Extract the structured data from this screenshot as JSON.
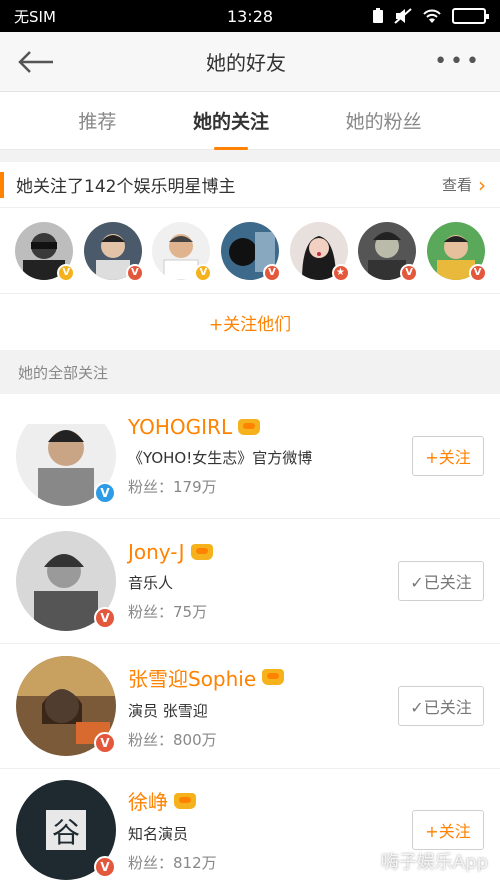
{
  "status_bar": {
    "carrier": "无SIM",
    "time": "13:28"
  },
  "nav": {
    "title": "她的好友"
  },
  "tabs": [
    {
      "label": "推荐"
    },
    {
      "label": "她的关注"
    },
    {
      "label": "她的粉丝"
    }
  ],
  "stars_section": {
    "title": "她关注了142个娱乐明星博主",
    "see_more": "查看",
    "follow_all": "+关注他们"
  },
  "list_header": "她的全部关注",
  "users": [
    {
      "name": "YOHOGIRL",
      "desc": "《YOHO!女生志》官方微博",
      "fans": "粉丝：179万",
      "action": "+关注"
    },
    {
      "name": "Jony-J",
      "desc": "音乐人",
      "fans": "粉丝：75万",
      "action": "✓已关注"
    },
    {
      "name": "张雪迎Sophie",
      "desc": "演员 张雪迎",
      "fans": "粉丝：800万",
      "action": "✓已关注"
    },
    {
      "name": "徐峥",
      "desc": "知名演员",
      "fans": "粉丝：812万",
      "action": "+关注"
    }
  ],
  "watermark": {
    "text": "嗨子娱乐App"
  },
  "colors": {
    "accent": "#ff8200",
    "gold_badge": "#f5b21c",
    "red_badge": "#e3573c",
    "blue_badge": "#2e9be6"
  }
}
